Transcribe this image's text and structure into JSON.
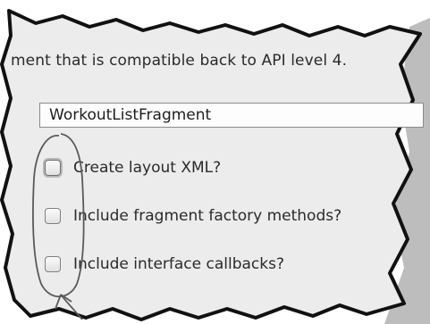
{
  "description": "ment that is compatible back to API level 4.",
  "fragment_name": {
    "value": "WorkoutListFragment",
    "placeholder": ""
  },
  "options": [
    {
      "label": "Create layout XML?",
      "checked": false
    },
    {
      "label": "Include fragment factory methods?",
      "checked": false
    },
    {
      "label": "Include interface callbacks?",
      "checked": false
    }
  ]
}
